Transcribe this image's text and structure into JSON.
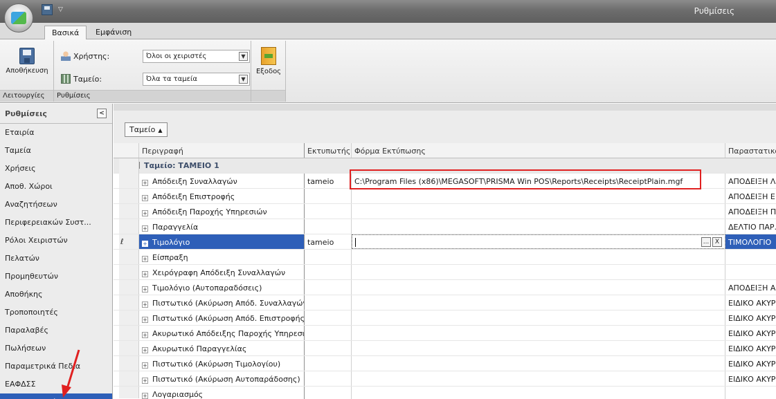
{
  "window": {
    "title": "Ρυθμίσεις"
  },
  "ribbon": {
    "tabs": [
      "Βασικά",
      "Εμφάνιση"
    ],
    "groups": {
      "operations": {
        "caption": "Λειτουργίες",
        "save_label": "Αποθήκευση"
      },
      "settings": {
        "caption": "Ρυθμίσεις",
        "user_label": "Χρήστης:",
        "user_value": "Όλοι οι χειριστές",
        "till_label": "Ταμείο:",
        "till_value": "Όλα τα ταμεία"
      },
      "exit": {
        "label": "Εξοδος"
      }
    }
  },
  "sidebar": {
    "title": "Ρυθμίσεις",
    "collapse_glyph": "<",
    "items": [
      "Εταιρία",
      "Ταμεία",
      "Χρήσεις",
      "Αποθ. Χώροι",
      "Αναζητήσεων",
      "Περιφερειακών Συστ...",
      "Ρόλοι Χειριστών",
      "Πελατών",
      "Προμηθευτών",
      "Αποθήκης",
      "Τροποποιητές",
      "Παραλαβές",
      "Πωλήσεων",
      "Παραμετρικά Πεδία",
      "ΕΑΦΔΣΣ",
      "Παραστατικά"
    ],
    "selected_index": 15
  },
  "grid": {
    "group_by_chip": "Ταμείο",
    "columns": [
      "Περιγραφή",
      "Εκτυπωτής",
      "Φόρμα Εκτύπωσης",
      "Παραστατικό"
    ],
    "group_title": "Ταμείο: ΤΑΜΕΙΟ 1",
    "rows": [
      {
        "desc": "Απόδειξη Συναλλαγών",
        "printer": "tameio",
        "form": "C:\\Program Files (x86)\\MEGASOFT\\PRISMA Win POS\\Reports\\Receipts\\ReceiptPlain.mgf",
        "doc": "ΑΠΟΔΕΙΞΗ Λ"
      },
      {
        "desc": "Απόδειξη Επιστροφής",
        "printer": "",
        "form": "",
        "doc": "ΑΠΟΔΕΙΞΗ Ε"
      },
      {
        "desc": "Απόδειξη Παροχής Υπηρεσιών",
        "printer": "",
        "form": "",
        "doc": "ΑΠΟΔΕΙΞΗ Π"
      },
      {
        "desc": "Παραγγελία",
        "printer": "",
        "form": "",
        "doc": "ΔΕΛΤΙΟ ΠΑΡ."
      },
      {
        "desc": "Τιμολόγιο",
        "printer": "tameio",
        "form": "",
        "doc": "ΤΙΜΟΛΟΓΙΟ"
      },
      {
        "desc": "Είσπραξη",
        "printer": "",
        "form": "",
        "doc": ""
      },
      {
        "desc": "Χειρόγραφη Απόδειξη Συναλλαγών",
        "printer": "",
        "form": "",
        "doc": ""
      },
      {
        "desc": "Τιμολόγιο (Αυτοπαραδόσεις)",
        "printer": "",
        "form": "",
        "doc": "ΑΠΟΔΕΙΞΗ Α"
      },
      {
        "desc": "Πιστωτικό (Ακύρωση Απόδ. Συναλλαγών)",
        "printer": "",
        "form": "",
        "doc": "ΕΙΔΙΚΟ ΑΚΥΡ"
      },
      {
        "desc": "Πιστωτικό (Ακύρωση Απόδ. Επιστροφής)",
        "printer": "",
        "form": "",
        "doc": "ΕΙΔΙΚΟ ΑΚΥΡ"
      },
      {
        "desc": "Ακυρωτικό Απόδειξης Παροχής Υπηρεσι...",
        "printer": "",
        "form": "",
        "doc": "ΕΙΔΙΚΟ ΑΚΥΡ"
      },
      {
        "desc": "Ακυρωτικό Παραγγελίας",
        "printer": "",
        "form": "",
        "doc": "ΕΙΔΙΚΟ ΑΚΥΡ"
      },
      {
        "desc": "Πιστωτικό (Ακύρωση Τιμολογίου)",
        "printer": "",
        "form": "",
        "doc": "ΕΙΔΙΚΟ ΑΚΥΡ"
      },
      {
        "desc": "Πιστωτικό (Ακύρωση Αυτοπαράδοσης)",
        "printer": "",
        "form": "",
        "doc": "ΕΙΔΙΚΟ ΑΚΥΡ"
      },
      {
        "desc": "Λογαριασμός",
        "printer": "",
        "form": "",
        "doc": ""
      }
    ],
    "selected_row_index": 4,
    "editor_buttons": [
      "...",
      "X"
    ]
  },
  "colors": {
    "selection": "#2e5fb8",
    "highlight_box": "#e02020",
    "annotation_arrow": "#e02020"
  }
}
